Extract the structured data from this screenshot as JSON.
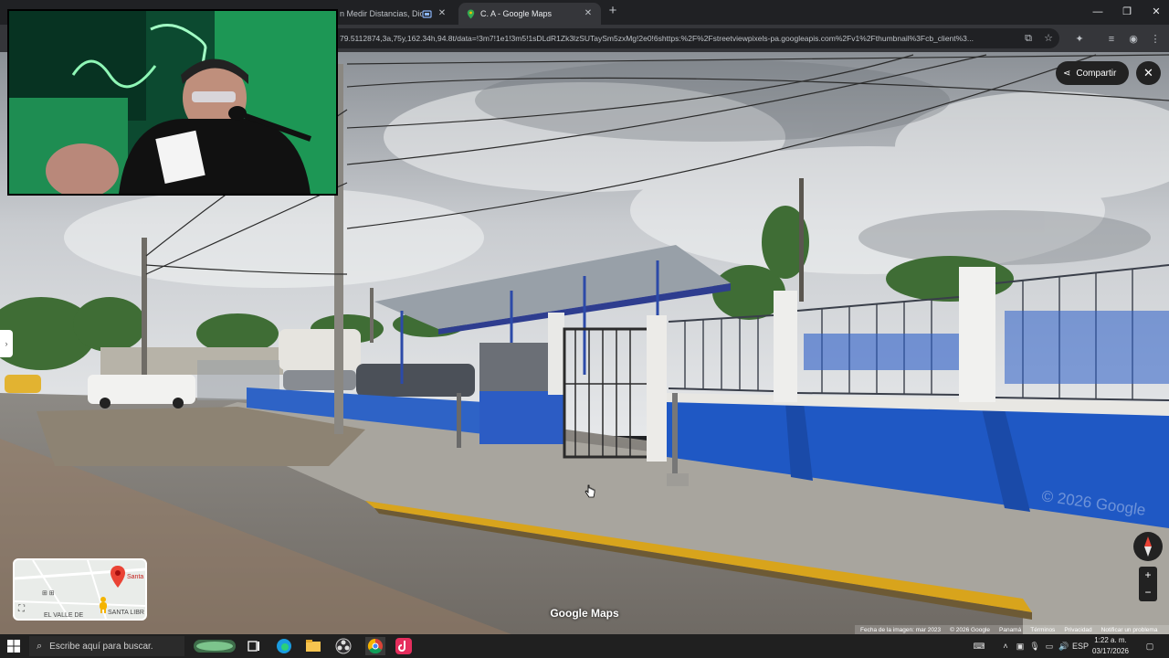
{
  "browser": {
    "tabs": [
      {
        "title": "n Medir Distancias, Diomedes",
        "active": false
      },
      {
        "title": "C. A - Google Maps",
        "active": true
      }
    ],
    "new_tab_icon": "plus-icon",
    "url": "79.5112874,3a,75y,162.34h,94.8t/data=!3m7!1e1!3m5!1sDLdR1Zk3lzSUTaySm5zxMg!2e0!6shttps:%2F%2Fstreetviewpixels-pa.googleapis.com%2Fv1%2Fthumbnail%3Fcb_client%3..."
  },
  "street_view": {
    "share_label": "Compartir",
    "brand": "Google Maps",
    "watermark": "© 2026 Google",
    "footer": {
      "image_date": "Fecha de la imagen: mar 2023",
      "copyright": "© 2026 Google",
      "country": "Panamá",
      "terms": "Términos",
      "privacy": "Privacidad",
      "report": "Notificar un problema"
    },
    "minimap": {
      "place_label": "Santa",
      "district_1": "EL VALLE DE",
      "district_2": "SANTA LIBR"
    },
    "zoom_in": "+",
    "zoom_out": "−"
  },
  "taskbar": {
    "search_placeholder": "Escribe aquí para buscar.",
    "language": "ESP",
    "time": "1:22 a. m.",
    "date": "03/17/2026"
  },
  "colors": {
    "wall_blue": "#1f58c4",
    "curb_yellow": "#d8a41c",
    "chrome_dark": "#202124",
    "chrome_mid": "#35363a"
  }
}
